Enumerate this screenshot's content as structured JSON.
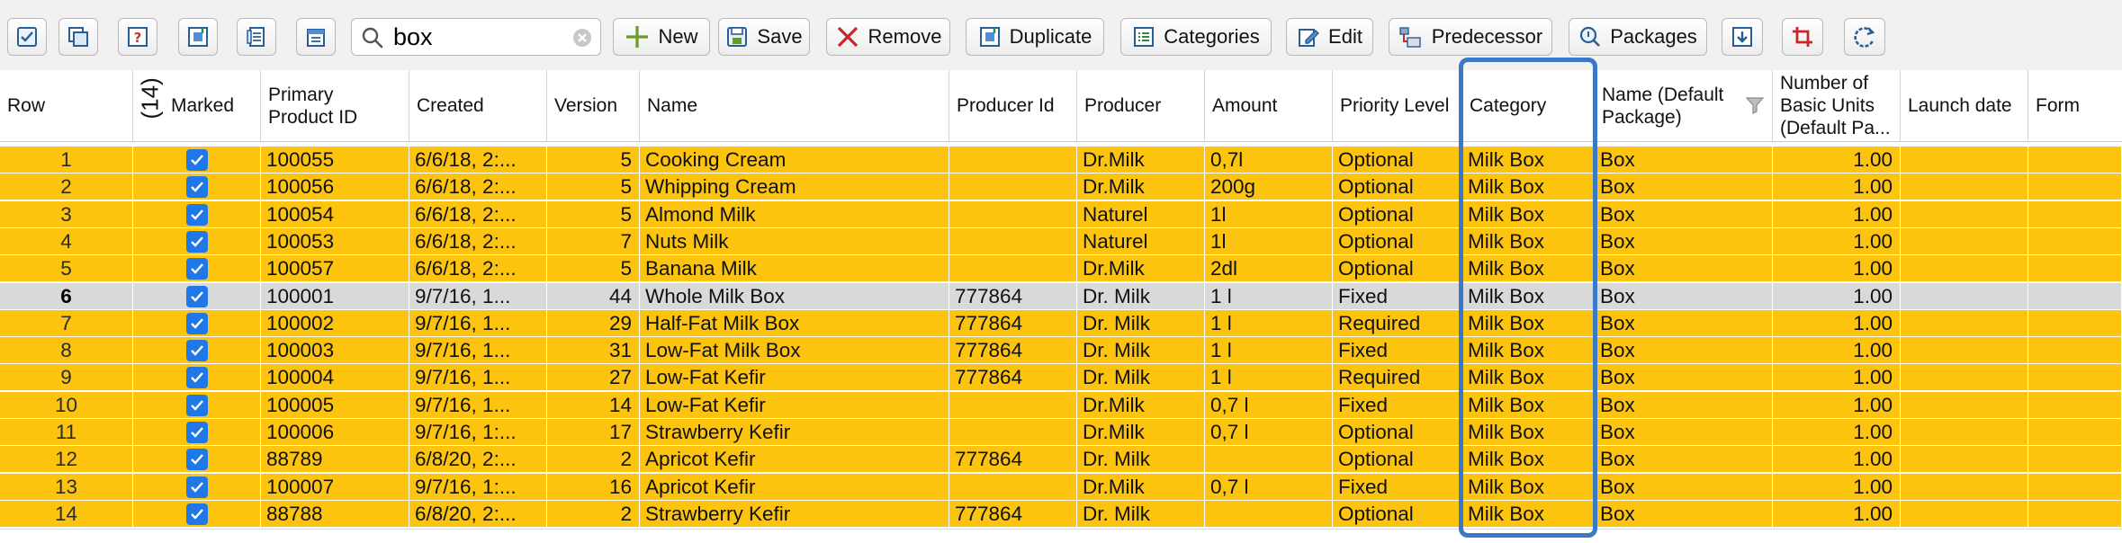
{
  "toolbar": {
    "search": {
      "value": "box",
      "placeholder": ""
    },
    "buttons": {
      "new": "New",
      "save": "Save",
      "remove": "Remove",
      "duplicate": "Duplicate",
      "categories": "Categories",
      "edit": "Edit",
      "predecessor": "Predecessor",
      "packages": "Packages"
    }
  },
  "table": {
    "columns": {
      "row": "Row",
      "marked_count": "(14)",
      "marked": "Marked",
      "primary_id": "Primary Product ID",
      "created": "Created",
      "version": "Version",
      "name": "Name",
      "producer_id": "Producer Id",
      "producer": "Producer",
      "amount": "Amount",
      "priority": "Priority Level",
      "category": "Category",
      "name_default_package": "Name (Default Package)",
      "basic_units": "Number of Basic Units (Default Pa...",
      "launch_date": "Launch date",
      "form": "Form"
    },
    "rows": [
      {
        "row": "1",
        "pid": "100055",
        "created": "6/6/18, 2:...",
        "version": "5",
        "name": "Cooking Cream",
        "producer_id": "",
        "producer": "Dr.Milk",
        "amount": "0,7l",
        "priority": "Optional",
        "category": "Milk Box",
        "pkg": "Box",
        "units": "1.00"
      },
      {
        "row": "2",
        "pid": "100056",
        "created": "6/6/18, 2:...",
        "version": "5",
        "name": "Whipping Cream",
        "producer_id": "",
        "producer": "Dr.Milk",
        "amount": "200g",
        "priority": "Optional",
        "category": "Milk Box",
        "pkg": "Box",
        "units": "1.00"
      },
      {
        "row": "3",
        "pid": "100054",
        "created": "6/6/18, 2:...",
        "version": "5",
        "name": "Almond Milk",
        "producer_id": "",
        "producer": "Naturel",
        "amount": "1l",
        "priority": "Optional",
        "category": "Milk Box",
        "pkg": "Box",
        "units": "1.00"
      },
      {
        "row": "4",
        "pid": "100053",
        "created": "6/6/18, 2:...",
        "version": "7",
        "name": "Nuts Milk",
        "producer_id": "",
        "producer": "Naturel",
        "amount": "1l",
        "priority": "Optional",
        "category": "Milk Box",
        "pkg": "Box",
        "units": "1.00"
      },
      {
        "row": "5",
        "pid": "100057",
        "created": "6/6/18, 2:...",
        "version": "5",
        "name": "Banana Milk",
        "producer_id": "",
        "producer": "Dr.Milk",
        "amount": "2dl",
        "priority": "Optional",
        "category": "Milk Box",
        "pkg": "Box",
        "units": "1.00"
      },
      {
        "row": "6",
        "pid": "100001",
        "created": "9/7/16, 1...",
        "version": "44",
        "name": "Whole Milk Box",
        "producer_id": "777864",
        "producer": "Dr. Milk",
        "amount": "1 l",
        "priority": "Fixed",
        "category": "Milk Box",
        "pkg": "Box",
        "units": "1.00",
        "selected": true
      },
      {
        "row": "7",
        "pid": "100002",
        "created": "9/7/16, 1...",
        "version": "29",
        "name": "Half-Fat Milk Box",
        "producer_id": "777864",
        "producer": "Dr. Milk",
        "amount": "1 l",
        "priority": "Required",
        "category": "Milk Box",
        "pkg": "Box",
        "units": "1.00"
      },
      {
        "row": "8",
        "pid": "100003",
        "created": "9/7/16, 1...",
        "version": "31",
        "name": "Low-Fat Milk Box",
        "producer_id": "777864",
        "producer": "Dr. Milk",
        "amount": "1 l",
        "priority": "Fixed",
        "category": "Milk Box",
        "pkg": "Box",
        "units": "1.00"
      },
      {
        "row": "9",
        "pid": "100004",
        "created": "9/7/16, 1...",
        "version": "27",
        "name": "Low-Fat Kefir",
        "producer_id": "777864",
        "producer": "Dr. Milk",
        "amount": "1 l",
        "priority": "Required",
        "category": "Milk Box",
        "pkg": "Box",
        "units": "1.00"
      },
      {
        "row": "10",
        "pid": "100005",
        "created": "9/7/16, 1...",
        "version": "14",
        "name": "Low-Fat Kefir",
        "producer_id": "",
        "producer": "Dr.Milk",
        "amount": "0,7 l",
        "priority": "Fixed",
        "category": "Milk Box",
        "pkg": "Box",
        "units": "1.00"
      },
      {
        "row": "11",
        "pid": "100006",
        "created": "9/7/16, 1:...",
        "version": "17",
        "name": "Strawberry Kefir",
        "producer_id": "",
        "producer": "Dr.Milk",
        "amount": "0,7 l",
        "priority": "Optional",
        "category": "Milk Box",
        "pkg": "Box",
        "units": "1.00"
      },
      {
        "row": "12",
        "pid": "88789",
        "created": "6/8/20, 2:...",
        "version": "2",
        "name": "Apricot Kefir",
        "producer_id": "777864",
        "producer": "Dr. Milk",
        "amount": "",
        "priority": "Optional",
        "category": "Milk Box",
        "pkg": "Box",
        "units": "1.00"
      },
      {
        "row": "13",
        "pid": "100007",
        "created": "9/7/16, 1:...",
        "version": "16",
        "name": "Apricot Kefir",
        "producer_id": "",
        "producer": "Dr.Milk",
        "amount": "0,7 l",
        "priority": "Fixed",
        "category": "Milk Box",
        "pkg": "Box",
        "units": "1.00"
      },
      {
        "row": "14",
        "pid": "88788",
        "created": "6/8/20, 2:...",
        "version": "2",
        "name": "Strawberry Kefir",
        "producer_id": "777864",
        "producer": "Dr. Milk",
        "amount": "",
        "priority": "Optional",
        "category": "Milk Box",
        "pkg": "Box",
        "units": "1.00"
      }
    ]
  },
  "colors": {
    "row_bg": "#fcc40e",
    "selected_row_bg": "#d9d9d9",
    "checkbox": "#1f77e8",
    "highlight_border": "#3b78c7"
  },
  "icons": {
    "toolbar": [
      "check-list-icon",
      "copy-window-icon",
      "help-window-icon",
      "import-icon",
      "pages-icon",
      "calendar-list-icon",
      "down-arrow-box-icon",
      "crop-icon",
      "refresh-icon"
    ],
    "search": "magnifier-icon",
    "clear": "clear-circle-icon",
    "filter": "funnel-icon"
  }
}
